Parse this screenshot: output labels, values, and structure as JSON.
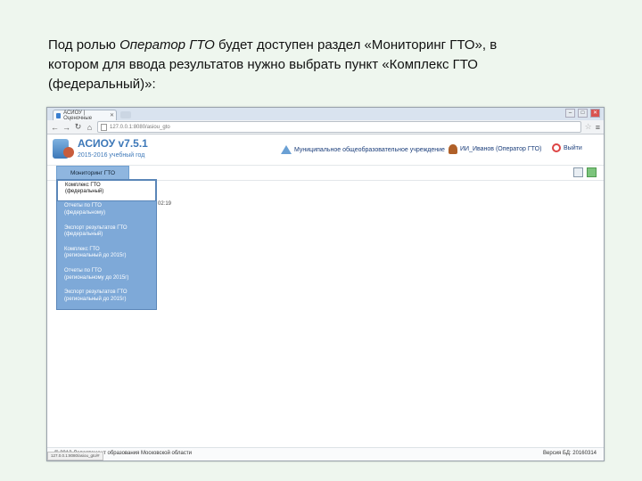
{
  "caption": {
    "line1_pre": "Под ролью ",
    "line1_role": "Оператор ГТО",
    "line1_post": " будет доступен раздел «Мониторинг ГТО», в",
    "line2": "котором для ввода результатов нужно выбрать пункт «Комплекс ГТО",
    "line3": "(федеральный)»:"
  },
  "browser": {
    "tab_title": "АСИОУ | Оценочные",
    "address": "127.0.0.1:8080/asiou_gto",
    "app": {
      "title": "АСИОУ v7.5.1",
      "school_year": "2015-2016 учебный год",
      "org_name": "Муниципальное общеобразовательное учреждение",
      "user_name": "ИИ_Иванов (Оператор ГТО)",
      "logout_label": "Выйти"
    },
    "menu_tab": "Мониторинг ГТО",
    "dropdown_items": [
      {
        "line1": "Комплекс ГТО",
        "line2": "(федеральный)"
      },
      {
        "line1": "Отчеты по ГТО",
        "line2": "(федеральному)"
      },
      {
        "line1": "Экспорт результатов ГТО",
        "line2": "(федеральный)"
      },
      {
        "line1": "Комплекс ГТО",
        "line2": "(региональный до 2015г)"
      },
      {
        "line1": "Отчеты по ГТО",
        "line2": "(региональному до 2015г)"
      },
      {
        "line1": "Экспорт результатов ГТО",
        "line2": "(региональный до 2015г)"
      }
    ],
    "stray_text": "02:19",
    "footer_left": "© 2012 Департамент образования Московской области",
    "footer_right": "Версия БД: 20160314",
    "status_url": "127.0.0.1:8080/asiou_gto/#"
  }
}
